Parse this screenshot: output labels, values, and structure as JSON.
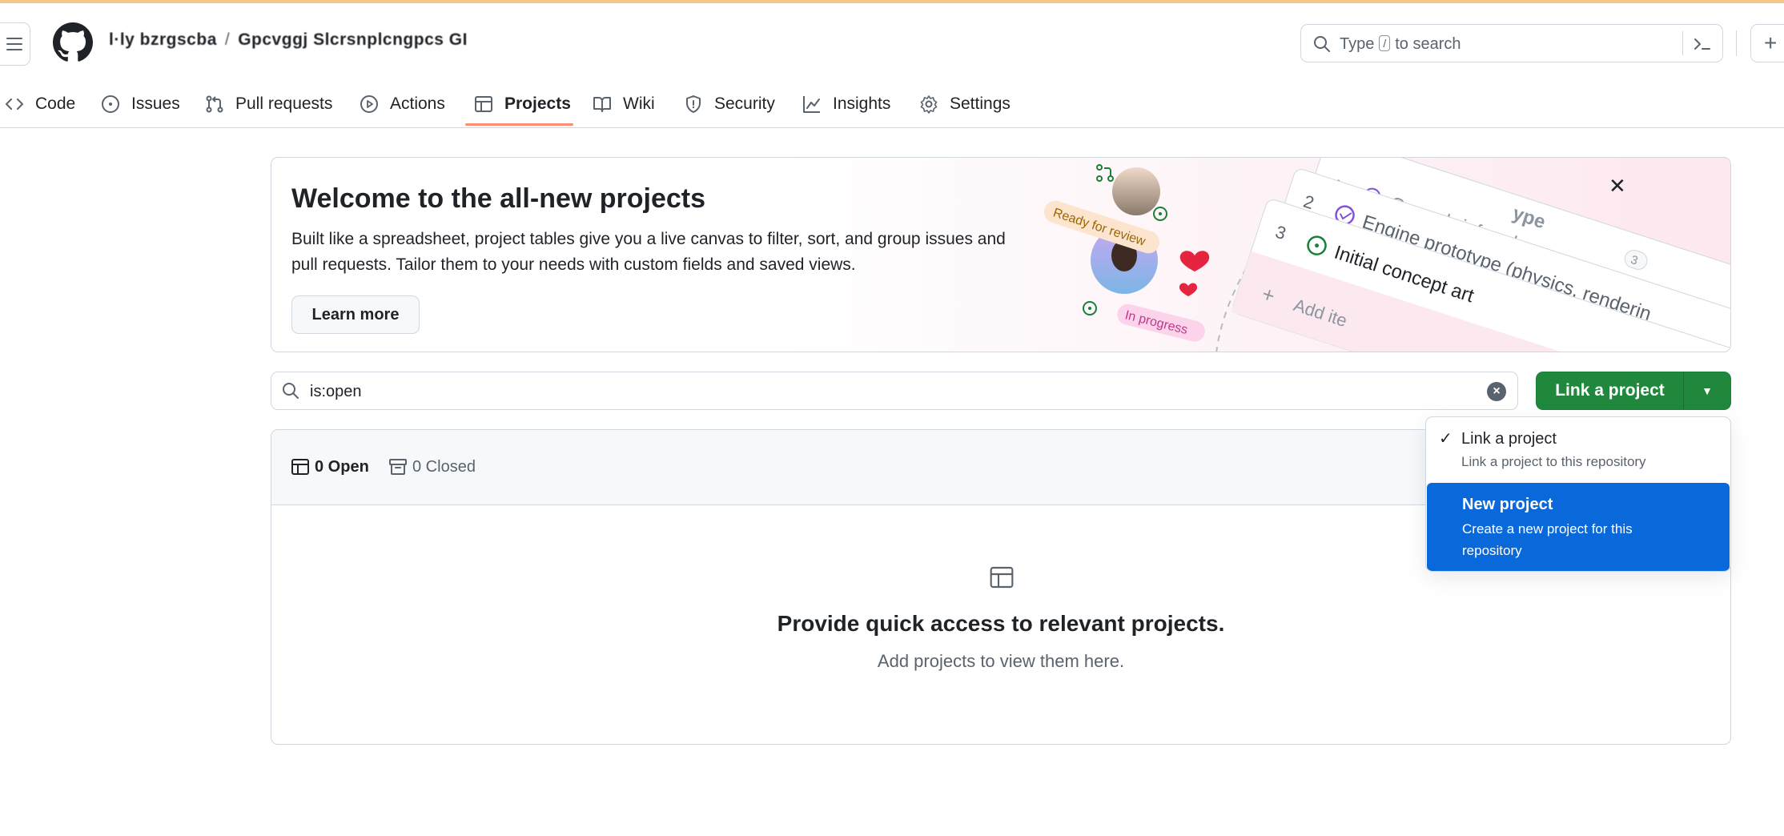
{
  "header": {
    "repo_owner": "l·ly bzrgscba",
    "repo_separator": "/",
    "repo_name": "Gpcvggj Slcrsnplcngpcs GI",
    "search_prefix": "Type",
    "search_key": "/",
    "search_suffix": "to search",
    "plus": "+"
  },
  "nav": {
    "tabs": [
      {
        "label": "Code",
        "icon": "code-icon"
      },
      {
        "label": "Issues",
        "icon": "issue-opened-icon"
      },
      {
        "label": "Pull requests",
        "icon": "git-pull-request-icon"
      },
      {
        "label": "Actions",
        "icon": "play-icon"
      },
      {
        "label": "Projects",
        "icon": "table-icon",
        "selected": true
      },
      {
        "label": "Wiki",
        "icon": "book-icon"
      },
      {
        "label": "Security",
        "icon": "shield-icon"
      },
      {
        "label": "Insights",
        "icon": "graph-icon"
      },
      {
        "label": "Settings",
        "icon": "gear-icon"
      }
    ]
  },
  "banner": {
    "title": "Welcome to the all-new projects",
    "description": "Built like a spreadsheet, project tables give you a live canvas to filter, sort, and group issues and pull requests. Tailor them to your needs with custom fields and saved views.",
    "learn_more": "Learn more",
    "close": "✕",
    "art": {
      "ready_for_review": "Ready for review",
      "in_progress": "In progress",
      "row1_num": "1",
      "row1_text": "Game brief and go-no",
      "row1_count": "3",
      "row0_text": "ype",
      "row2_num": "2",
      "row2_text": "Engine prototype (physics, renderin",
      "row3_num": "3",
      "row3_text": "Initial concept art",
      "add_item": "Add ite"
    }
  },
  "filter": {
    "value": "is:open",
    "clear": "×"
  },
  "link_button": {
    "label": "Link a project",
    "caret": "▼"
  },
  "list": {
    "open_label": "0 Open",
    "closed_label": "0 Closed",
    "empty_title": "Provide quick access to relevant projects.",
    "empty_subtitle": "Add projects to view them here."
  },
  "menu": {
    "items": [
      {
        "title": "Link a project",
        "description": "Link a project to this repository",
        "checked": true
      },
      {
        "title": "New project",
        "description": "Create a new project for this repository",
        "highlighted": true
      }
    ],
    "check": "✓"
  },
  "colors": {
    "accent_green": "#1f883d",
    "highlight_blue": "#0969da",
    "tab_underline": "#fd8c73",
    "border": "#d0d7de",
    "muted_text": "#59636e"
  }
}
